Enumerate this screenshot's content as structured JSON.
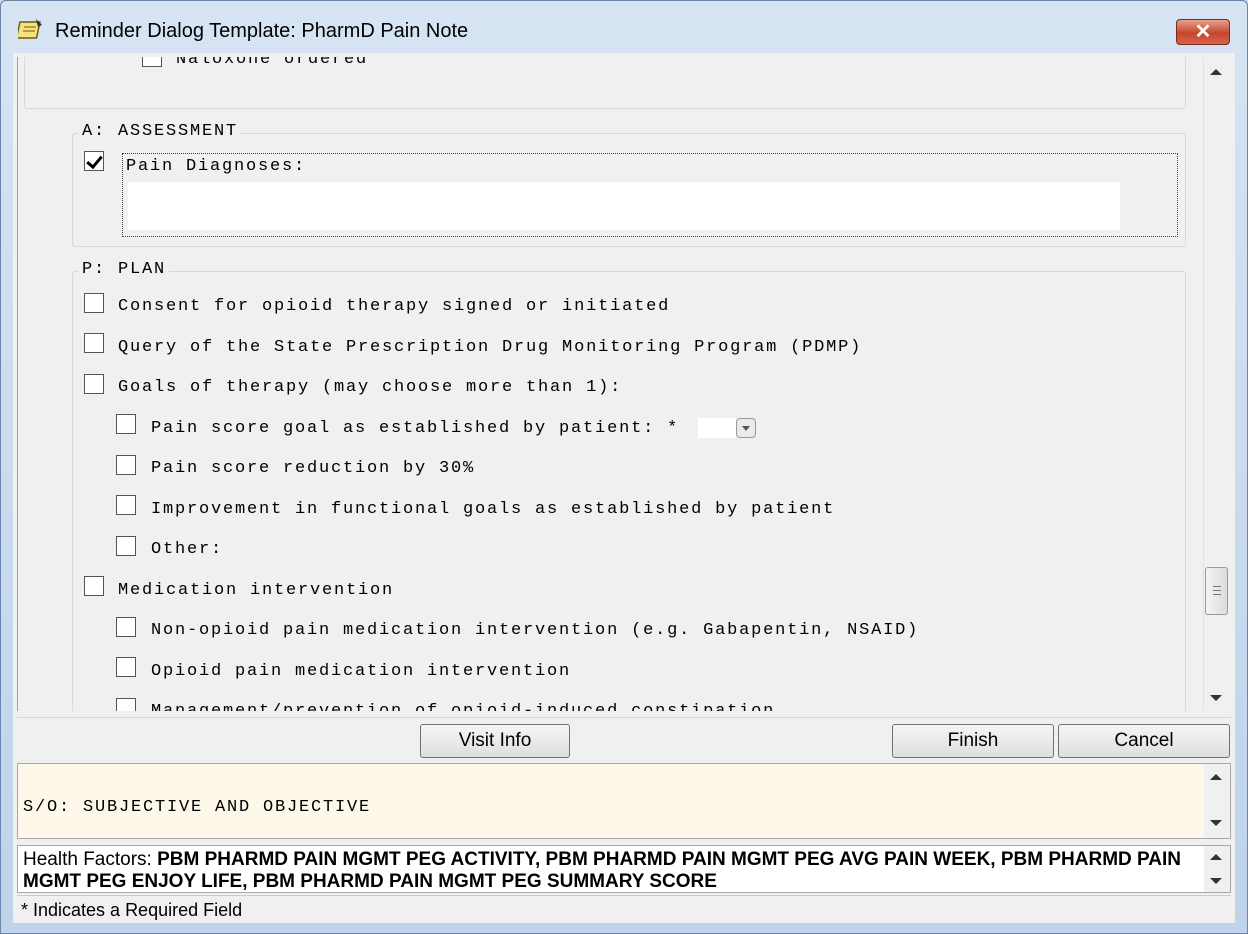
{
  "window": {
    "title": "Reminder Dialog Template: PharmD Pain Note",
    "close_glyph": "✕"
  },
  "top_item": {
    "label": "Naloxone ordered"
  },
  "assessment": {
    "heading": "A: ASSESSMENT",
    "pain_diagnoses": {
      "label": "Pain Diagnoses:",
      "checked": true,
      "value": ""
    }
  },
  "plan": {
    "heading": "P: PLAN",
    "items": [
      {
        "label": "Consent for opioid therapy signed or initiated",
        "checked": false
      },
      {
        "label": "Query of the State Prescription Drug Monitoring Program (PDMP)",
        "checked": false
      },
      {
        "label": "Goals of therapy (may choose more than 1):",
        "checked": false
      },
      {
        "label": "Pain score goal as established by patient: *",
        "checked": false
      },
      {
        "label": "Pain score reduction by 30%",
        "checked": false
      },
      {
        "label": "Improvement in functional goals as established by patient",
        "checked": false
      },
      {
        "label": "Other:",
        "checked": false
      },
      {
        "label": "Medication intervention",
        "checked": false
      },
      {
        "label": "Non-opioid pain medication intervention (e.g. Gabapentin, NSAID)",
        "checked": false
      },
      {
        "label": "Opioid pain medication intervention",
        "checked": false
      },
      {
        "label": "Management/prevention of opioid-induced constipation",
        "checked": false
      }
    ]
  },
  "buttons": {
    "visit_info": "Visit Info",
    "finish": "Finish",
    "cancel": "Cancel"
  },
  "preview": {
    "text": "S/O: SUBJECTIVE AND OBJECTIVE"
  },
  "health_factors": {
    "label": "Health Factors: ",
    "value": "PBM PHARMD PAIN MGMT PEG ACTIVITY, PBM PHARMD PAIN MGMT PEG AVG PAIN WEEK, PBM PHARMD PAIN MGMT PEG ENJOY LIFE, PBM PHARMD PAIN MGMT PEG SUMMARY SCORE"
  },
  "status": {
    "text": "* Indicates a Required Field"
  },
  "icons": {
    "app": "notepad-icon",
    "close": "close-icon",
    "scroll_up": "scroll-up-arrow-icon",
    "scroll_down": "scroll-down-arrow-icon",
    "dropdown": "dropdown-arrow-icon"
  },
  "colors": {
    "preview_bg": "#fdf8ea",
    "close_button": "#c7452c",
    "titlebar": "#c9d7e8"
  }
}
